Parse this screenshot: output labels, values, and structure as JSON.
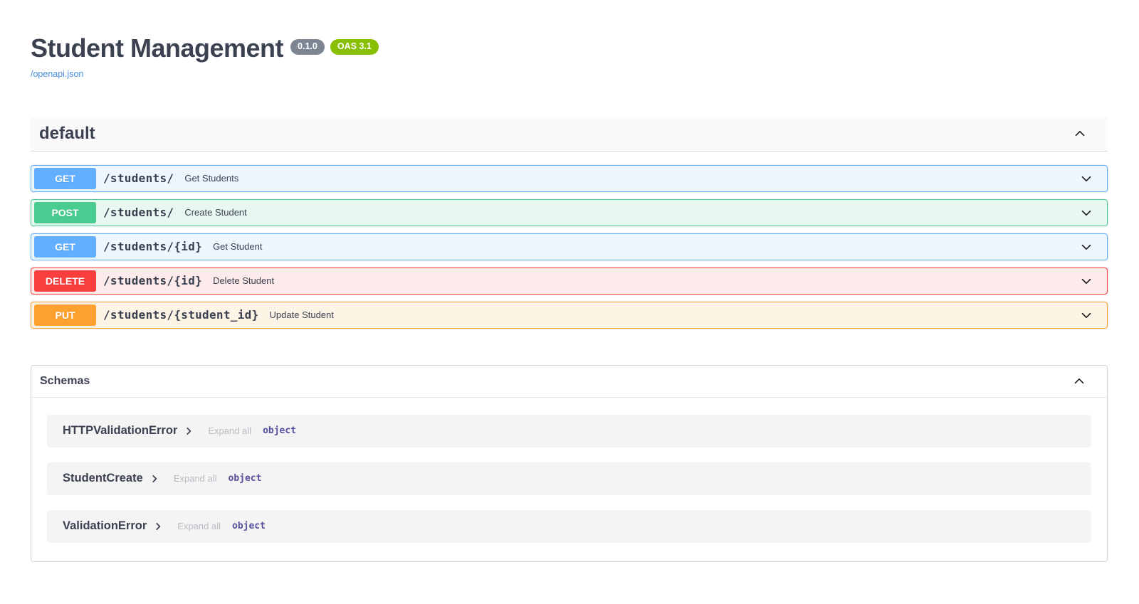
{
  "info": {
    "title": "Student Management",
    "version_badge": "0.1.0",
    "oas_badge": "OAS 3.1",
    "spec_link": "/openapi.json"
  },
  "tag_section": {
    "name": "default",
    "operations": [
      {
        "method": "GET",
        "path": "/students/",
        "summary": "Get Students",
        "color": "#61affe",
        "bg": "#eef6ff"
      },
      {
        "method": "POST",
        "path": "/students/",
        "summary": "Create Student",
        "color": "#49cc90",
        "bg": "#e8f8f1"
      },
      {
        "method": "GET",
        "path": "/students/{id}",
        "summary": "Get Student",
        "color": "#61affe",
        "bg": "#eef6ff"
      },
      {
        "method": "DELETE",
        "path": "/students/{id}",
        "summary": "Delete Student",
        "color": "#f93e3e",
        "bg": "#fdeaea"
      },
      {
        "method": "PUT",
        "path": "/students/{student_id}",
        "summary": "Update Student",
        "color": "#fca130",
        "bg": "#fef4e6"
      }
    ]
  },
  "schemas_section": {
    "title": "Schemas",
    "expand_all_label": "Expand all",
    "models": [
      {
        "name": "HTTPValidationError",
        "type": "object"
      },
      {
        "name": "StudentCreate",
        "type": "object"
      },
      {
        "name": "ValidationError",
        "type": "object"
      }
    ]
  },
  "colors": {
    "get": "#61affe",
    "post": "#49cc90",
    "delete": "#f93e3e",
    "put": "#fca130",
    "version_pill": "#7d8492",
    "oas_pill": "#89bf04",
    "link": "#4990e2",
    "heading_text": "#3b4151",
    "model_type_text": "#554fa0"
  }
}
